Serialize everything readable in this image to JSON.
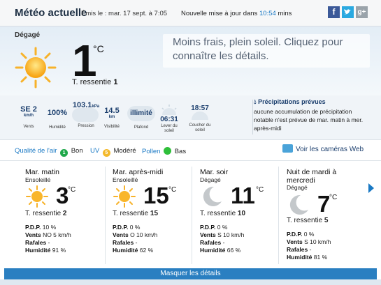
{
  "header": {
    "title": "Météo actuelle",
    "issued": "Émis le : mar. 17 sept. à 7:05",
    "update_prefix": "Nouvelle mise à jour dans",
    "update_time": "10:54",
    "update_suffix": "mins",
    "social": {
      "facebook": "f",
      "twitter": "t",
      "googleplus": "g+"
    }
  },
  "current": {
    "condition": "Dégagé",
    "temp": "1",
    "unit": "°C",
    "feels_label": "T. ressentie",
    "feels_value": "1",
    "promo": "Moins frais, plein soleil. Cliquez pour connaître les détails."
  },
  "details": {
    "wind": {
      "value": "SE 2",
      "unit": "km/h",
      "label": "Vents"
    },
    "humidity": {
      "value": "100%",
      "label": "Humidité"
    },
    "pressure": {
      "value": "103.1",
      "unit": "kPa",
      "label": "Pression"
    },
    "visibility": {
      "value": "14.5",
      "unit": "km",
      "label": "Visibilité"
    },
    "ceiling": {
      "value": "illimité",
      "label": "Plafond"
    },
    "sunrise": {
      "value": "06:31",
      "label1": "Lever du",
      "label2": "soleil"
    },
    "sunset": {
      "value": "18:57",
      "label1": "Coucher du",
      "label2": "soleil"
    }
  },
  "precipitation": {
    "title": "Précipitations prévues",
    "text": "aucune accumulation de précipitation notable n'est prévue de mar. matin à mer. après-midi"
  },
  "quality": {
    "air_label": "Qualité de l'air",
    "air_index": "1",
    "air_value": "Bon",
    "uv_label": "UV",
    "uv_index": "5",
    "uv_value": "Modéré",
    "pollen_label": "Pollen",
    "pollen_value": "Bas",
    "cams": "Voir les caméras Web"
  },
  "colors": {
    "air": "#1fa84a",
    "uv": "#f4b92b",
    "pollen": "#2fbf3a",
    "accent": "#1a79c4"
  },
  "forecast": [
    {
      "name": "Mar. matin",
      "condition": "Ensoleillé",
      "icon": "sun-icon",
      "temp": "3",
      "unit": "°C",
      "feels_label": "T. ressentie",
      "feels": "2",
      "pdp_label": "P.D.P.",
      "pdp": "10 %",
      "wind_label": "Vents",
      "wind": "NO 5 km/h",
      "gust_label": "Rafales",
      "gust": "-",
      "hum_label": "Humidité",
      "hum": "91 %"
    },
    {
      "name": "Mar. après-midi",
      "condition": "Ensoleillé",
      "icon": "sun-icon",
      "temp": "15",
      "unit": "°C",
      "feels_label": "T. ressentie",
      "feels": "15",
      "pdp_label": "P.D.P.",
      "pdp": "0 %",
      "wind_label": "Vents",
      "wind": "O 10 km/h",
      "gust_label": "Rafales",
      "gust": "-",
      "hum_label": "Humidité",
      "hum": "62 %"
    },
    {
      "name": "Mar. soir",
      "condition": "Dégagé",
      "icon": "moon-icon",
      "temp": "11",
      "unit": "°C",
      "feels_label": "T. ressentie",
      "feels": "10",
      "pdp_label": "P.D.P.",
      "pdp": "0 %",
      "wind_label": "Vents",
      "wind": "S 10 km/h",
      "gust_label": "Rafales",
      "gust": "-",
      "hum_label": "Humidité",
      "hum": "66 %"
    },
    {
      "name": "Nuit de mardi à mercredi",
      "condition": "Dégagé",
      "icon": "moon-icon",
      "temp": "7",
      "unit": "°C",
      "feels_label": "T. ressentie",
      "feels": "5",
      "pdp_label": "P.D.P.",
      "pdp": "0 %",
      "wind_label": "Vents",
      "wind": "S 10 km/h",
      "gust_label": "Rafales",
      "gust": "-",
      "hum_label": "Humidité",
      "hum": "81 %"
    }
  ],
  "footer": {
    "toggle": "Masquer les détails"
  }
}
